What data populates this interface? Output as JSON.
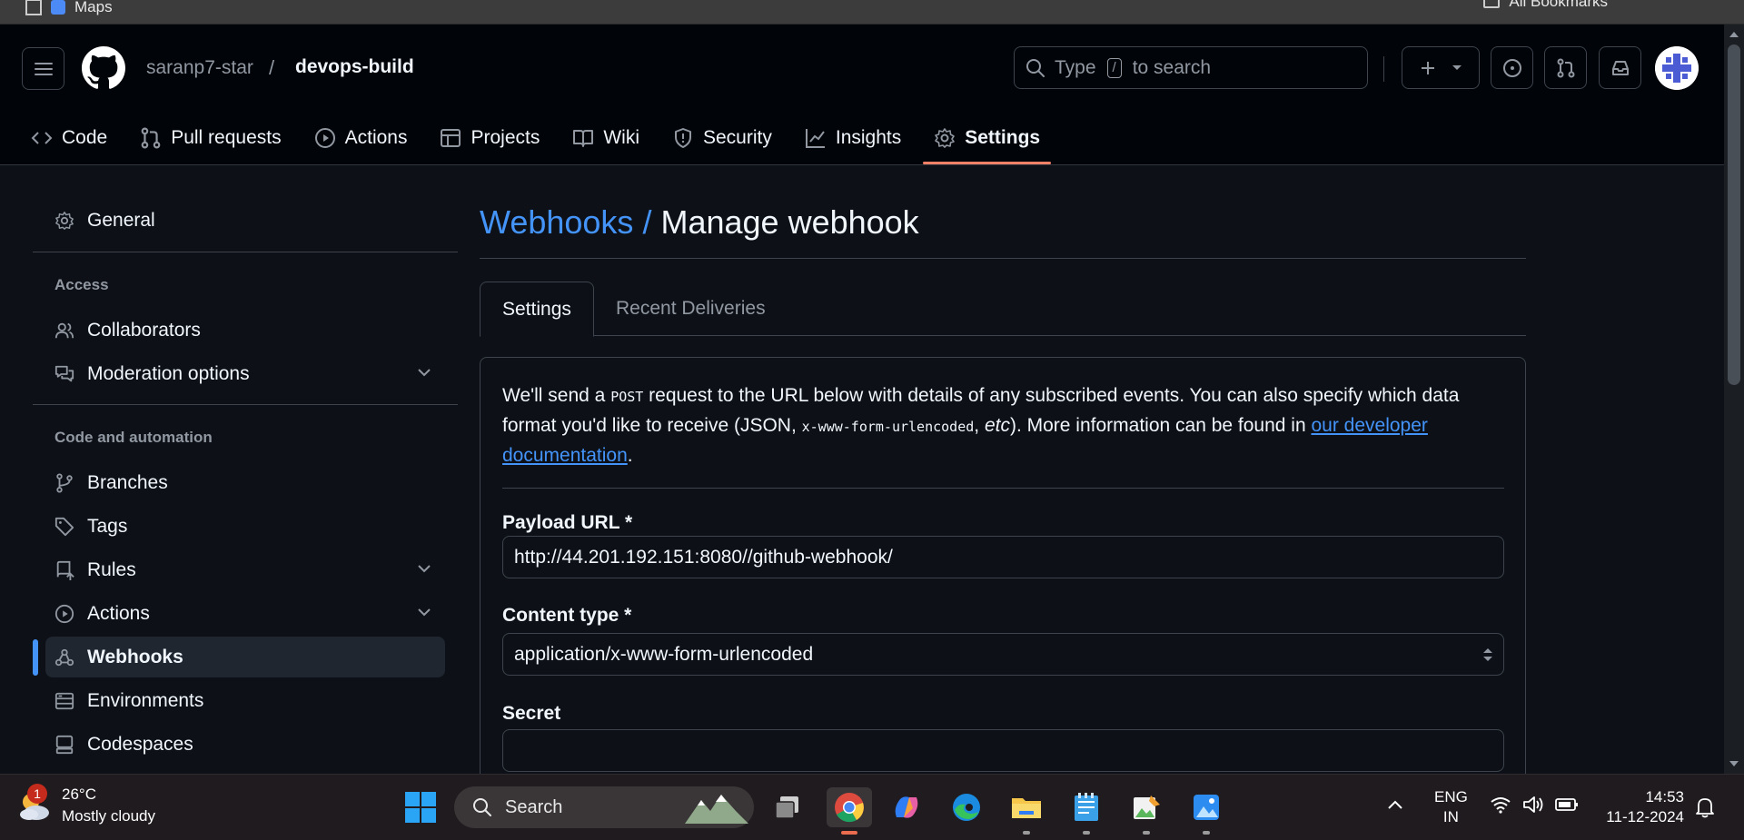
{
  "browser": {
    "tab_fragment": "Maps",
    "bookmarks_fragment": "All Bookmarks"
  },
  "header": {
    "owner": "saranp7-star",
    "separator": "/",
    "repo": "devops-build",
    "search": {
      "prefix": "Type",
      "key": "/",
      "suffix": "to search"
    }
  },
  "repo_nav": [
    {
      "label": "Code",
      "icon": "code-icon"
    },
    {
      "label": "Pull requests",
      "icon": "pull-request-icon"
    },
    {
      "label": "Actions",
      "icon": "play-icon"
    },
    {
      "label": "Projects",
      "icon": "table-icon"
    },
    {
      "label": "Wiki",
      "icon": "book-icon"
    },
    {
      "label": "Security",
      "icon": "shield-icon"
    },
    {
      "label": "Insights",
      "icon": "graph-icon"
    },
    {
      "label": "Settings",
      "icon": "gear-icon",
      "active": true
    }
  ],
  "sidebar": {
    "general": "General",
    "access_heading": "Access",
    "collaborators": "Collaborators",
    "moderation": "Moderation options",
    "code_heading": "Code and automation",
    "branches": "Branches",
    "tags": "Tags",
    "rules": "Rules",
    "actions": "Actions",
    "webhooks": "Webhooks",
    "environments": "Environments",
    "codespaces": "Codespaces"
  },
  "main": {
    "crumb": "Webhooks /",
    "title": "Manage webhook",
    "tabs": {
      "settings": "Settings",
      "recent": "Recent Deliveries"
    },
    "desc": {
      "p1": "We'll send a ",
      "post": "POST",
      "p2": " request to the URL below with details of any subscribed events. You can also specify which data format you'd like to receive (JSON, ",
      "urlenc": "x-www-form-urlencoded",
      "p3": ", ",
      "etc": "etc",
      "p4": "). More information can be found in ",
      "link": "our developer documentation",
      "p5": "."
    },
    "payload_label": "Payload URL *",
    "payload_value": "http://44.201.192.151:8080//github-webhook/",
    "content_type_label": "Content type *",
    "content_type_value": "application/x-www-form-urlencoded",
    "secret_label": "Secret",
    "secret_value": ""
  },
  "taskbar": {
    "weather_badge": "1",
    "temp": "26°C",
    "condition": "Mostly cloudy",
    "search": "Search",
    "lang_top": "ENG",
    "lang_bottom": "IN",
    "time": "14:53",
    "date": "11-12-2024"
  },
  "colors": {
    "accent": "#4493f8",
    "tab_underline": "#f78166",
    "bg": "#0d1117"
  }
}
